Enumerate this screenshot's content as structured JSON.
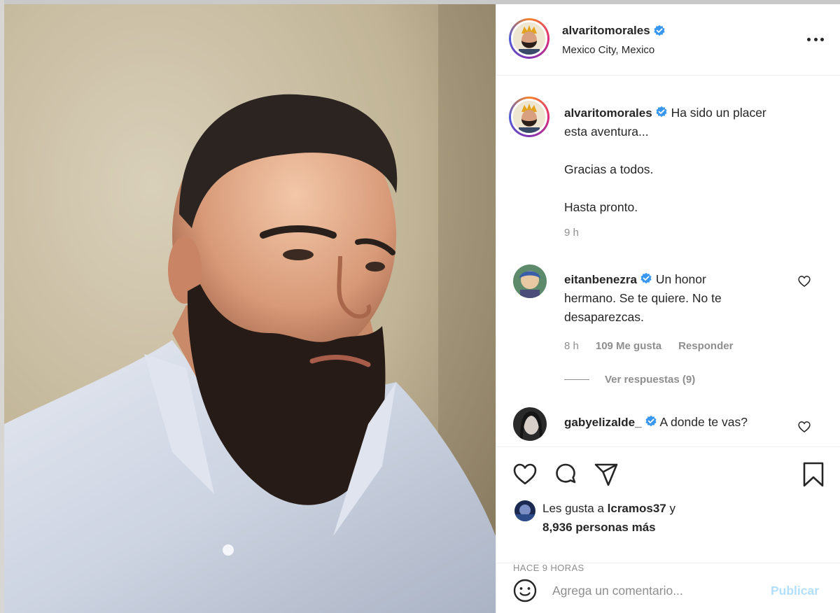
{
  "post": {
    "username": "alvaritomorales",
    "location": "Mexico City, Mexico",
    "caption_lines": [
      "Ha sido un placer",
      "esta aventura..."
    ],
    "caption_p2": "Gracias a todos.",
    "caption_p3": "Hasta pronto.",
    "caption_time": "9 h",
    "likes_prefix": "Les gusta a",
    "likes_user": "lcramos37",
    "likes_conj": "y",
    "likes_count": "8,936 personas más",
    "posted_ago": "HACE 9 HORAS"
  },
  "comments": [
    {
      "username": "eitanbenezra",
      "text_first": "Un honor",
      "text_rest": [
        "hermano. Se te quiere. No te",
        "desaparezcas."
      ],
      "time": "8 h",
      "likes": "109 Me gusta",
      "reply": "Responder",
      "view_replies": "Ver respuestas (9)"
    },
    {
      "username": "gabyelizalde_",
      "text_first": "A donde te vas?"
    }
  ],
  "comment_box": {
    "placeholder": "Agrega un comentario...",
    "publish": "Publicar"
  },
  "colors": {
    "verified": "#3897f0",
    "text": "#262626",
    "muted": "#8e8e8e",
    "publish_disabled": "#b2dffc"
  },
  "icons": [
    "verified-badge-icon",
    "more-options-icon",
    "heart-icon",
    "comment-icon",
    "share-icon",
    "bookmark-icon",
    "emoji-icon"
  ]
}
